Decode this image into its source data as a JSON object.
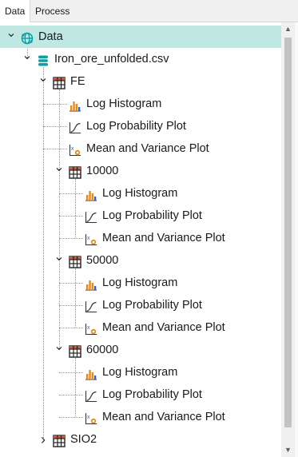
{
  "tabs": [
    "Data",
    "Process"
  ],
  "tree": [
    {
      "label": "Data",
      "icon": "globe-icon",
      "depth": 0,
      "expanded": true,
      "selected": true
    },
    {
      "label": "Iron_ore_unfolded.csv",
      "icon": "database-icon",
      "depth": 1,
      "expanded": true
    },
    {
      "label": "FE",
      "icon": "table-icon",
      "depth": 2,
      "expanded": true
    },
    {
      "label": "Log Histogram",
      "icon": "histogram-icon",
      "depth": 3
    },
    {
      "label": "Log Probability Plot",
      "icon": "probability-plot-icon",
      "depth": 3
    },
    {
      "label": "Mean and Variance Plot",
      "icon": "mean-variance-icon",
      "depth": 3
    },
    {
      "label": "10000",
      "icon": "table-icon",
      "depth": 3,
      "expanded": true
    },
    {
      "label": "Log Histogram",
      "icon": "histogram-icon",
      "depth": 4
    },
    {
      "label": "Log Probability Plot",
      "icon": "probability-plot-icon",
      "depth": 4
    },
    {
      "label": "Mean and Variance Plot",
      "icon": "mean-variance-icon",
      "depth": 4
    },
    {
      "label": "50000",
      "icon": "table-icon",
      "depth": 3,
      "expanded": true
    },
    {
      "label": "Log Histogram",
      "icon": "histogram-icon",
      "depth": 4
    },
    {
      "label": "Log Probability Plot",
      "icon": "probability-plot-icon",
      "depth": 4
    },
    {
      "label": "Mean and Variance Plot",
      "icon": "mean-variance-icon",
      "depth": 4
    },
    {
      "label": "60000",
      "icon": "table-icon",
      "depth": 3,
      "expanded": true
    },
    {
      "label": "Log Histogram",
      "icon": "histogram-icon",
      "depth": 4
    },
    {
      "label": "Log Probability Plot",
      "icon": "probability-plot-icon",
      "depth": 4
    },
    {
      "label": "Mean and Variance Plot",
      "icon": "mean-variance-icon",
      "depth": 4
    },
    {
      "label": "SIO2",
      "icon": "table-icon",
      "depth": 2,
      "expanded": false
    }
  ],
  "colors": {
    "selection": "#bfe8e3",
    "accent": "#0e9fa3",
    "histogram": "#e58a1f",
    "probability": "#3a3a3a"
  }
}
